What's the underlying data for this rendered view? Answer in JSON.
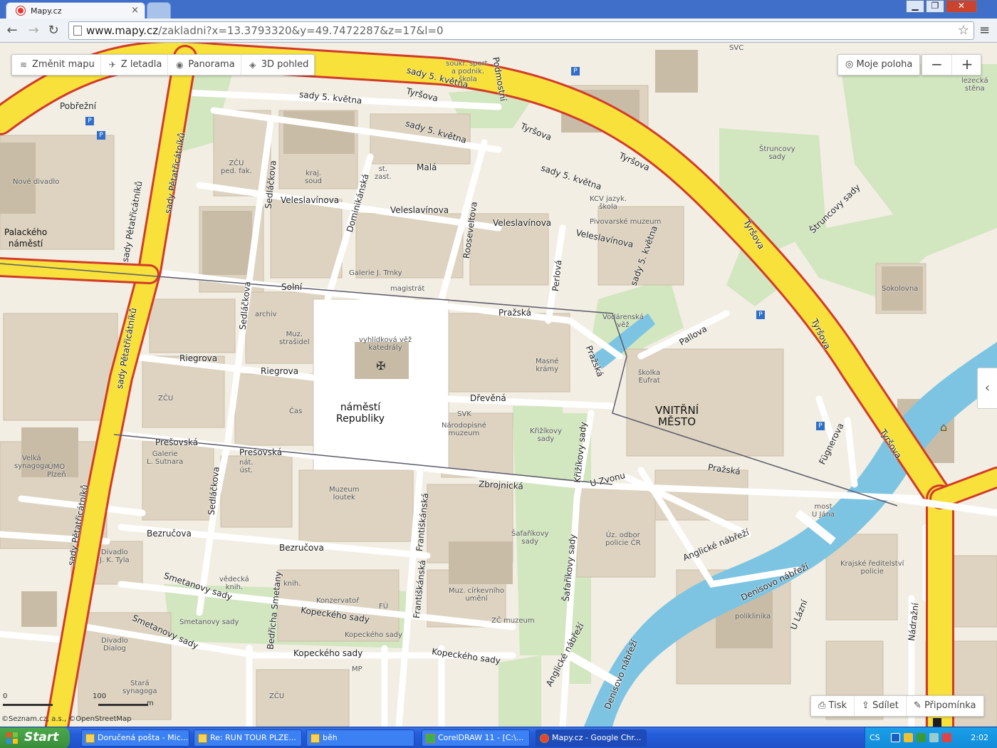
{
  "browser": {
    "tab_title": "Mapy.cz",
    "url_host": "www.mapy.cz",
    "url_rest": "/zakladni?x=13.3793320&y=49.7472287&z=17&l=0"
  },
  "map_toolbar": {
    "change_map": "Změnit mapu",
    "aerial": "Z letadla",
    "panorama": "Panorama",
    "view3d": "3D pohled"
  },
  "controls": {
    "my_location": "Moje poloha",
    "zoom_out": "−",
    "zoom_in": "+",
    "side_toggle": "‹",
    "print": "Tisk",
    "share": "Sdílet",
    "note": "Připomínka",
    "scale_left": "0",
    "scale_mid": "100",
    "scale_unit": "m",
    "copyright": "©Seznam.cz, a.s., ©OpenStreetMap"
  },
  "labels": {
    "streets": {
      "tyrsova": "Tyršova",
      "sady5kvetna": "sady 5. května",
      "pobrezni": "Pobřežní",
      "mala": "Malá",
      "veleslavinova": "Veleslavínova",
      "solni": "Solní",
      "prazska": "Pražská",
      "riegrova": "Riegrova",
      "presovska": "Prešovská",
      "drevena": "Dřevěná",
      "zbrojnicka": "Zbrojnická",
      "bezrucova": "Bezručova",
      "smetanovy_sady": "Smetanovy sady",
      "kopeckeho_sady": "Kopeckého sady",
      "franciskanska": "Františkánská",
      "sedlackova": "Sedláčkova",
      "dominikanska": "Dominikánská",
      "rooseveltova": "Rooseveltova",
      "perlova": "Perlová",
      "sady_petatricatniku": "sady Pětatřicátníků",
      "krizikovy_sady": "Křižíkovy sady",
      "safarikovy_sady": "Šafaříkovy sady",
      "u_zvonu": "U Zvonu",
      "pallova": "Pallova",
      "fugnerova": "Fügnerova",
      "anglicke_nabrezi": "Anglické nábřeží",
      "denisovo_nabrezi": "Denisovo nábřeží",
      "u_lazni": "U Lázní",
      "nadrazni": "Nádražní",
      "strunkovy_sady_street": "Štruncovy sady",
      "podmostni": "Podmostní",
      "bedricha_smetany": "Bedřicha Smetany",
      "prazska2": "Pražská"
    },
    "places": {
      "namesti": "náměstí\nRepubliky",
      "vnitrni_mesto": "VNITŘNÍ\nMĚSTO",
      "palackeho": "Palackého\nnáměstí",
      "katedrala": "vyhlídková věž\nkatedrály",
      "nove_divadlo": "Nové divadlo",
      "zcu_ped": "ZČU\nped. fak.",
      "kraj_soud": "kraj.\nsoud",
      "kcv": "KCV jazyk.\nškola",
      "pivovarske": "Pivovarské muzeum",
      "vodarenska": "Vodárenská\nvěž",
      "strunkovy": "Štruncovy\nsady",
      "sokolovna": "Sokolovna",
      "skolka": "školka\nEufrat",
      "masne": "Masné\nkrámy",
      "svk": "SVK",
      "narodopisne": "Národopisné\nmuzeum",
      "krizikovy": "Křižíkovy\nsady",
      "safarikovy": "Šafaříkovy\nsady",
      "velka_synagoga": "Velká\nsynagoga",
      "galerie_sutnara": "Galerie\nL. Sutnara",
      "muzeum_loutek": "Muzeum\nloutek",
      "divadlo_tyla": "Divadlo\nJ. K. Tyla",
      "divadlo_dialog": "Divadlo\nDialog",
      "stara_synagoga": "Stará\nsynagoga",
      "konzervator": "Konzervatoř",
      "muz_cirkevniho": "Muz. církevního\numění",
      "zc_muzeum": "ZČ muzeum",
      "uz_odbor": "Úz. odbor\npolicie ČR",
      "poliklinika": "poliklinika",
      "krajske_policie": "Krajské ředitelství\npolicie",
      "most": "most\nU Jána",
      "archiv": "archiv",
      "muz_strasidel": "Muz.\nstrašidel",
      "cas": "Čas",
      "zcu": "ZČU",
      "zcu2": "ZČU",
      "galerie_trnky": "Galerie J. Trnky",
      "magistrat": "magistrát",
      "umo": "ÚMO\nPlzeň",
      "fu": "FÚ",
      "sadiky": "Smetanovy sady",
      "kopeckeho_sady_place": "Kopeckého sady",
      "soukr_skola": "soukr. sport.\na podnik.\nškola",
      "lezecka": "lezecká\nstěna",
      "svc": "SVC",
      "vedecka": "vědecká\nknih.",
      "nat_ustav": "nát.\núst.",
      "knih": "knih.",
      "mp": "MP",
      "st_zast": "st.\nzast."
    }
  },
  "taskbar": {
    "start": "Start",
    "tasks": [
      "Doručená pošta - Mic...",
      "Re: RUN TOUR PLZE...",
      "běh",
      "CorelDRAW 11 - [C:\\...",
      "Mapy.cz - Google Chr..."
    ],
    "lang": "CS",
    "clock": "2:02"
  },
  "colors": {
    "main_road": "#f7e13a",
    "road_border": "#d33a2a",
    "park": "#cfe6bf",
    "river": "#7fc6e3",
    "building": "#dcd2bf",
    "taskbar": "#245edb"
  }
}
